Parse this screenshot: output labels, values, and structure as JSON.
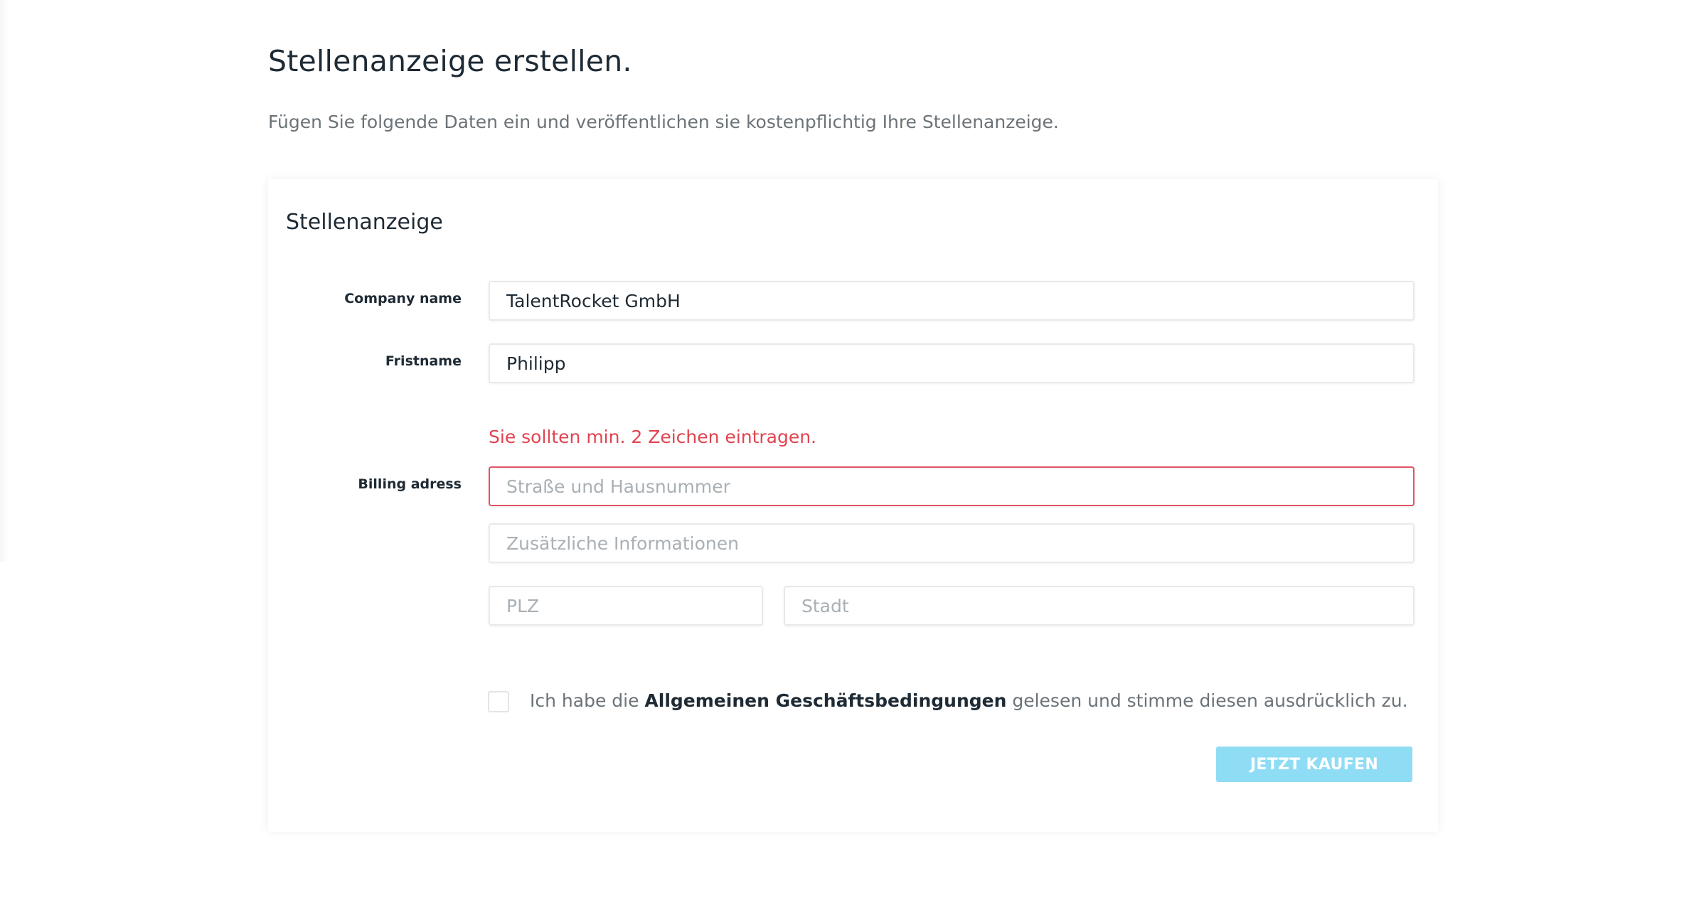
{
  "page": {
    "title": "Stellenanzeige erstellen.",
    "subtitle": "Fügen Sie folgende Daten ein und veröffentlichen sie kostenpflichtig Ihre Stellenanzeige."
  },
  "form": {
    "card_title": "Stellenanzeige",
    "company": {
      "label": "Company name",
      "value": "TalentRocket GmbH"
    },
    "firstname": {
      "label": "Fristname",
      "value": "Philipp"
    },
    "billing": {
      "label": "Billing adress",
      "error": "Sie sollten min. 2 Zeichen eintragen.",
      "street_placeholder": "Straße und Hausnummer",
      "extra_placeholder": "Zusätzliche Informationen",
      "zip_placeholder": "PLZ",
      "city_placeholder": "Stadt"
    },
    "consent": {
      "before": "Ich habe die ",
      "link": "Allgemeinen Geschäftsbedingungen",
      "after": " gelesen und stimme diesen ausdrücklich zu."
    },
    "submit_label": "JETZT KAUFEN"
  },
  "colors": {
    "error": "#e2434f",
    "button": "#8fdcf5"
  }
}
